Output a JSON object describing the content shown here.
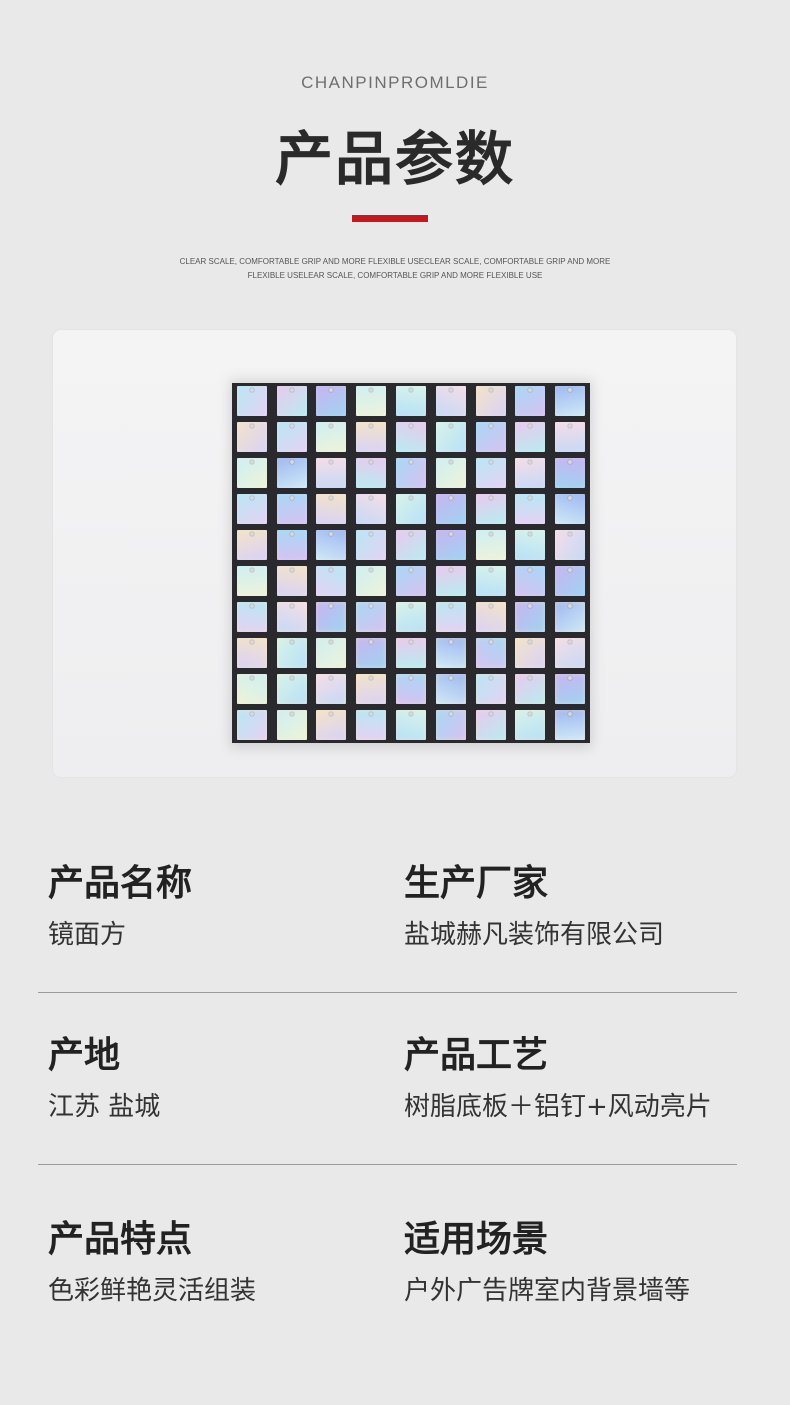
{
  "header": {
    "subtitle_en": "CHANPINPROMLDIE",
    "title_cn": "产品参数",
    "desc_line1": "CLEAR SCALE, COMFORTABLE GRIP AND MORE FLEXIBLE USECLEAR SCALE, COMFORTABLE GRIP AND MORE",
    "desc_line2": "FLEXIBLE USELEAR SCALE, COMFORTABLE GRIP AND MORE FLEXIBLE USE",
    "accent_color": "#c8161d"
  },
  "product_image": {
    "subject": "iridescent square sequin shimmer wall panel",
    "grid_rows": 10,
    "grid_cols": 9
  },
  "specs": [
    {
      "label": "产品名称",
      "value": "镜面方"
    },
    {
      "label": "生产厂家",
      "value": "盐城赫凡装饰有限公司"
    },
    {
      "label": "产地",
      "value": "江苏 盐城"
    },
    {
      "label": "产品工艺",
      "value": "树脂底板＋铝钉+风动亮片"
    },
    {
      "label": "产品特点",
      "value": "色彩鲜艳灵活组装"
    },
    {
      "label": "适用场景",
      "value": "户外广告牌室内背景墙等"
    }
  ]
}
